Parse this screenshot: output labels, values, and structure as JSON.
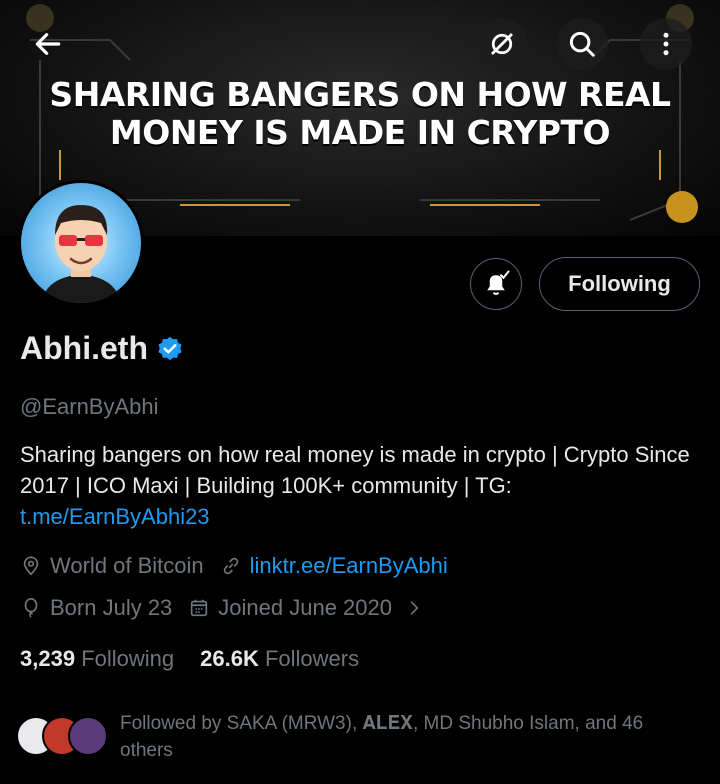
{
  "banner": {
    "text": "SHARING BANGERS ON HOW REAL MONEY IS MADE IN CRYPTO"
  },
  "icons": {
    "back": "arrow-left-icon",
    "grok": "grok-icon",
    "search": "search-icon",
    "more": "more-vertical-icon",
    "bell": "bell-check-icon"
  },
  "actions": {
    "follow_label": "Following"
  },
  "profile": {
    "name": "Abhi.eth",
    "handle": "@EarnByAbhi",
    "bio_text": "Sharing bangers on how real money is made in crypto | Crypto Since 2017 | ICO Maxi | Building 100K+ community | TG: ",
    "bio_link": "t.me/EarnByAbhi23",
    "location": "World of Bitcoin",
    "website": "linktr.ee/EarnByAbhi",
    "birthday": "Born July 23",
    "joined": "Joined June 2020"
  },
  "stats": {
    "following_count": "3,239",
    "following_label": "Following",
    "followers_count": "26.6K",
    "followers_label": "Followers"
  },
  "followed_by": {
    "text": "Followed by SAKA (MRW3), 𝐀𝐋𝐄𝐗, MD Shubho Islam, and 46 others"
  },
  "colors": {
    "accent": "#1d9bf0",
    "background": "#000000",
    "muted": "#71767b",
    "text": "#e7e9ea"
  }
}
